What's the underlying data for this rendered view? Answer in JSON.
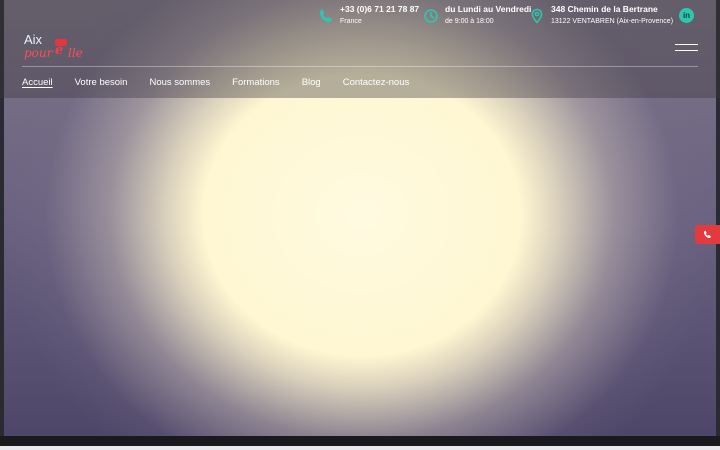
{
  "contact": {
    "phone_line1": "+33 (0)6 71 21 78 87",
    "phone_line2": "France",
    "hours_line1": "du Lundi au Vendredi",
    "hours_line2": "de 9:00 à 18:00",
    "address_line1": "348 Chemin de la Bertrane",
    "address_line2": "13122 VENTABREN (Aix-en-Provence)"
  },
  "social": {
    "linkedin": "in"
  },
  "logo": {
    "line1": "Aix",
    "part1": "pour",
    "part2": "e",
    "part3": "lle"
  },
  "nav": [
    {
      "label": "Accueil"
    },
    {
      "label": "Votre besoin"
    },
    {
      "label": "Nous sommes"
    },
    {
      "label": "Formations"
    },
    {
      "label": "Blog"
    },
    {
      "label": "Contactez-nous"
    }
  ],
  "colors": {
    "accent": "#2dc7b0",
    "brand_red": "#e23a3f"
  },
  "icons": [
    "phone-icon",
    "clock-icon",
    "map-pin-icon",
    "linkedin-icon",
    "menu-icon",
    "phone-call-icon"
  ]
}
